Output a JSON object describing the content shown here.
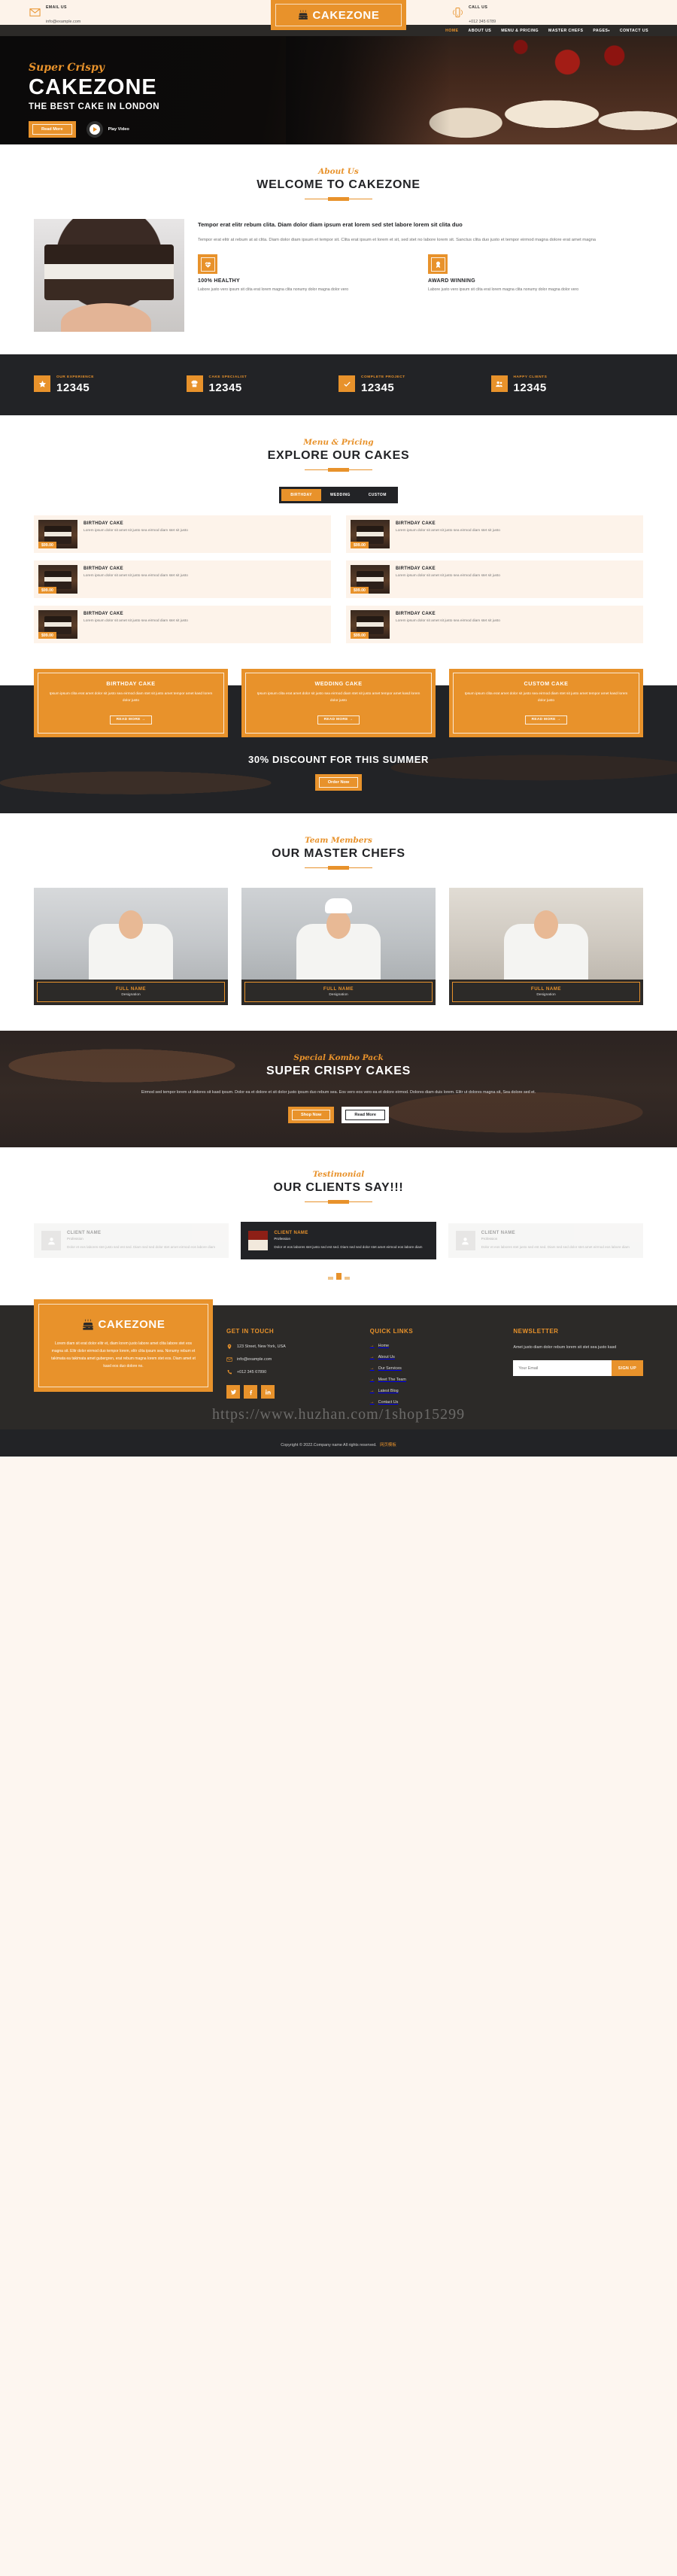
{
  "topbar": {
    "email_label": "EMAIL US",
    "email_value": "info@example.com",
    "call_label": "CALL US",
    "call_value": "+012 345 6789"
  },
  "brand": {
    "name": "CAKEZONE"
  },
  "nav": {
    "items": [
      {
        "label": "HOME",
        "active": true
      },
      {
        "label": "ABOUT US",
        "active": false
      },
      {
        "label": "MENU & PRICING",
        "active": false
      },
      {
        "label": "MASTER CHEFS",
        "active": false
      },
      {
        "label": "PAGES",
        "active": false,
        "caret": "▾"
      },
      {
        "label": "CONTACT US",
        "active": false
      }
    ]
  },
  "hero": {
    "script": "Super Crispy",
    "title": "CAKEZONE",
    "subtitle": "THE BEST CAKE IN LONDON",
    "primary_button": "Read More",
    "play_label": "Play Video"
  },
  "about": {
    "script": "About Us",
    "title": "WELCOME TO CAKEZONE",
    "lead": "Tempor erat elitr rebum clita. Diam dolor diam ipsum erat lorem sed stet labore lorem sit clita duo",
    "body": "Tempor erat elitr at rebum at at clita. Diam dolor diam ipsum et tempor sit. Clita erat ipsum et lorem et sit, sed stet no labore lorem sit. Sanctus clita duo justo et tempor eirmod magna dolore erat amet magna",
    "features": [
      {
        "icon": "heartbeat-icon",
        "title": "100% HEALTHY",
        "body": "Labore justo vero ipsum sit clita erat lorem magna clita nonumy dolor magna dolor vero"
      },
      {
        "icon": "award-icon",
        "title": "AWARD WINNING",
        "body": "Labore justo vero ipsum sit clita erat lorem magna clita nonumy dolor magna dolor vero"
      }
    ]
  },
  "facts": {
    "items": [
      {
        "icon": "star-icon",
        "label": "OUR EXPERIENCE",
        "value": "12345"
      },
      {
        "icon": "chef-icon",
        "label": "CAKE SPECIALIST",
        "value": "12345"
      },
      {
        "icon": "check-icon",
        "label": "COMPLETE PROJECT",
        "value": "12345"
      },
      {
        "icon": "users-icon",
        "label": "HAPPY CLIENTS",
        "value": "12345"
      }
    ]
  },
  "menu": {
    "script": "Menu & Pricing",
    "title": "EXPLORE OUR CAKES",
    "tabs": [
      {
        "label": "BIRTHDAY",
        "active": true
      },
      {
        "label": "WEDDING",
        "active": false
      },
      {
        "label": "CUSTOM",
        "active": false
      }
    ],
    "items": [
      {
        "name": "BIRTHDAY CAKE",
        "price": "$99.00",
        "desc": "Lorem ipsum dolor sit amet sit justo sea eirmod diam stet sit justo"
      },
      {
        "name": "BIRTHDAY CAKE",
        "price": "$99.00",
        "desc": "Lorem ipsum dolor sit amet sit justo sea eirmod diam stet sit justo"
      },
      {
        "name": "BIRTHDAY CAKE",
        "price": "$99.00",
        "desc": "Lorem ipsum dolor sit amet sit justo sea eirmod diam stet sit justo"
      },
      {
        "name": "BIRTHDAY CAKE",
        "price": "$99.00",
        "desc": "Lorem ipsum dolor sit amet sit justo sea eirmod diam stet sit justo"
      },
      {
        "name": "BIRTHDAY CAKE",
        "price": "$99.00",
        "desc": "Lorem ipsum dolor sit amet sit justo sea eirmod diam stet sit justo"
      },
      {
        "name": "BIRTHDAY CAKE",
        "price": "$99.00",
        "desc": "Lorem ipsum dolor sit amet sit justo sea eirmod diam stet sit justo"
      }
    ]
  },
  "packages": {
    "items": [
      {
        "title": "BIRTHDAY CAKE",
        "desc": "Ipsum ipsum clita erat amet dolor sit justo sea eirmod diam stet sit justo amet tempor amet kasd lorem dolor justo",
        "more": "READ MORE →"
      },
      {
        "title": "WEDDING CAKE",
        "desc": "Ipsum ipsum clita erat amet dolor sit justo sea eirmod diam stet sit justo amet tempor amet kasd lorem dolor justo",
        "more": "READ MORE →"
      },
      {
        "title": "CUSTOM CAKE",
        "desc": "Ipsum ipsum clita erat amet dolor sit justo sea eirmod diam stet sit justo amet tempor amet kasd lorem dolor justo",
        "more": "READ MORE →"
      }
    ]
  },
  "discount": {
    "heading": "30% DISCOUNT FOR THIS SUMMER",
    "button": "Order Now"
  },
  "team": {
    "script": "Team Members",
    "title": "OUR MASTER CHEFS",
    "members": [
      {
        "name": "FULL NAME",
        "role": "Designation"
      },
      {
        "name": "FULL NAME",
        "role": "Designation"
      },
      {
        "name": "FULL NAME",
        "role": "Designation"
      }
    ]
  },
  "combo": {
    "script": "Special Kombo Pack",
    "title": "SUPER CRISPY CAKES",
    "body": "Eirmod sed tempor lorem ut dolores sit kasd ipsum. Dolor ea et dolore et sit dolor justo ipsum duo rebum sea. Eos vero eos vero ea et dolore eirmod. Dolores diam duis lorem. Elitr ut dolores magna sit, Sea dolore sed et.",
    "primary_button": "Shop Now",
    "secondary_button": "Read More"
  },
  "testimonial": {
    "script": "Testimonial",
    "title": "OUR CLIENTS SAY!!!",
    "cards": [
      {
        "name": "CLIENT NAME",
        "role": "Profession",
        "text": "Dolor et eos labores stet justo sed est sed. Diam sed sed dolor stet amet eirmod eos labore diam",
        "active": false
      },
      {
        "name": "CLIENT NAME",
        "role": "Profession",
        "text": "Dolor et eos labores stet justo sed est sed. Diam sed sed dolor stet amet eirmod eos labore diam",
        "active": true
      },
      {
        "name": "CLIENT NAME",
        "role": "Profession",
        "text": "Dolor et eos labores stet justo sed est sed. Diam sed sed dolor stet amet eirmod eos labore diam",
        "active": false
      }
    ]
  },
  "footer": {
    "brand_name": "CAKEZONE",
    "brand_body": "Lorem diam sit erat dolor elitr et, diam lorem justo labore amet clita labore stet eos magna sit. Elitr dolor eirmod duo tempor lorem, elitr clita ipsum sea. Nonumy rebum et takimata ea takimata amet gubergren, erat rebum magna lorem stet eos. Diam amet et kasd eos duo dolore no.",
    "contact_title": "GET IN TOUCH",
    "contacts": [
      {
        "icon": "location-icon",
        "value": "123 Street, New York, USA"
      },
      {
        "icon": "envelope-icon",
        "value": "info@example.com"
      },
      {
        "icon": "phone-icon",
        "value": "+012 345 67890"
      }
    ],
    "social": [
      "twitter-icon",
      "facebook-icon",
      "linkedin-icon"
    ],
    "links_title": "QUICK LINKS",
    "links": [
      "Home",
      "About Us",
      "Our Services",
      "Meet The Team",
      "Latest Blog",
      "Contact Us"
    ],
    "newsletter_title": "NEWSLETTER",
    "newsletter_body": "Amet justo diam dolor rebum lorem sit stet sea justo kasd",
    "email_placeholder": "Your Email",
    "signup_label": "Sign Up",
    "watermark": "https://www.huzhan.com/1shop15299",
    "copyright": "Copyright © 2022.Company name All rights reserved.",
    "copyright_cn": "网页模板"
  },
  "colors": {
    "accent": "#e8922b",
    "dark": "#222326",
    "cream": "#fdf3ea"
  }
}
